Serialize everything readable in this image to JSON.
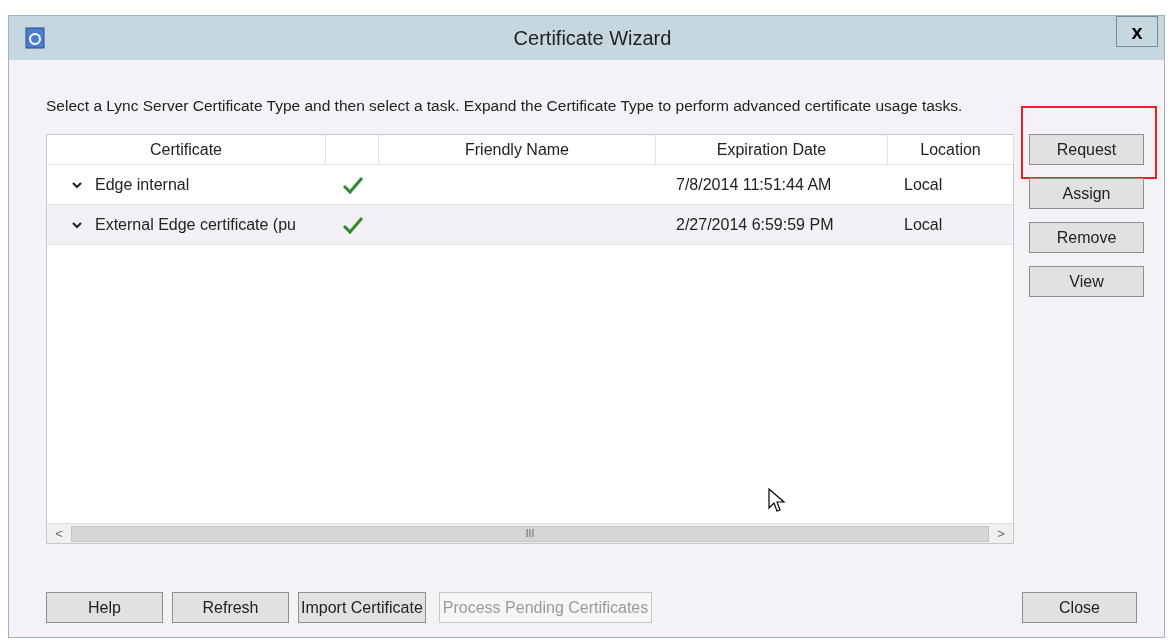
{
  "window": {
    "title": "Certificate Wizard",
    "close": "x"
  },
  "instruction": "Select a Lync Server Certificate Type and then select a task. Expand the Certificate Type to perform advanced certificate usage tasks.",
  "table": {
    "columns": [
      "Certificate",
      "",
      "Friendly Name",
      "Expiration Date",
      "Location"
    ],
    "rows": [
      {
        "certificate": "Edge internal",
        "expanded": false,
        "valid": true,
        "friendly_name": "",
        "expiration": "7/8/2014 11:51:44 AM",
        "location": "Local"
      },
      {
        "certificate": "External Edge certificate (pu",
        "expanded": false,
        "valid": true,
        "friendly_name": "",
        "expiration": "2/27/2014 6:59:59 PM",
        "location": "Local"
      }
    ],
    "scrollbar": {
      "left": "<",
      "grip": "III",
      "right": ">"
    }
  },
  "side_buttons": [
    {
      "label": "Request",
      "highlighted": true
    },
    {
      "label": "Assign",
      "highlighted": false
    },
    {
      "label": "Remove",
      "highlighted": false
    },
    {
      "label": "View",
      "highlighted": false
    }
  ],
  "bottom_buttons": [
    {
      "label": "Help",
      "disabled": false
    },
    {
      "label": "Refresh",
      "disabled": false
    },
    {
      "label": "Import Certificate",
      "disabled": false
    },
    {
      "label": "Process Pending Certificates",
      "disabled": true
    }
  ],
  "close_button": "Close"
}
